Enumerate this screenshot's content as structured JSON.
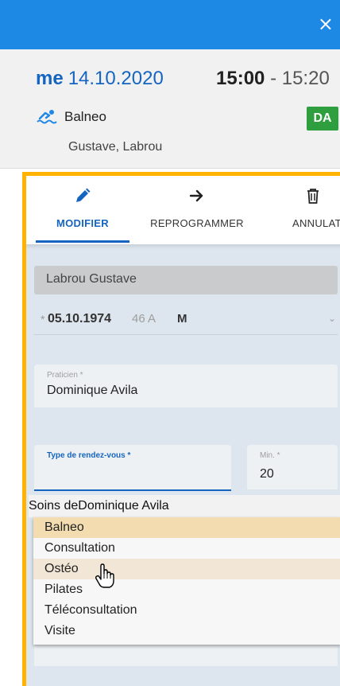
{
  "topbar": {
    "close_glyph": "×",
    "accent": "#1e88e5"
  },
  "appointment": {
    "day": "me",
    "date": "14.10.2020",
    "start": "15:00",
    "separator": "-",
    "end": "15:20",
    "activity": "Balneo",
    "activity_icon": "swimmer-icon",
    "badge": "DA",
    "badge_color": "#2e9e3e",
    "names": "Gustave, Labrou"
  },
  "tabs": [
    {
      "label": "MODIFIER",
      "icon": "pencil-icon",
      "active": true
    },
    {
      "label": "REPROGRAMMER",
      "icon": "arrow-right-icon",
      "active": false
    },
    {
      "label": "ANNULAT",
      "icon": "trash-icon",
      "active": false
    }
  ],
  "patient": {
    "name": "Labrou Gustave",
    "dob_marker": "*",
    "dob": "05.10.1974",
    "age": "46 A",
    "sex": "M"
  },
  "form": {
    "praticien_label": "Praticien *",
    "praticien_value": "Dominique Avila",
    "type_label": "Type de rendez-vous *",
    "type_value": "",
    "min_label": "Min. *",
    "min_value": "20"
  },
  "dropdown": {
    "group_label": "Soins deDominique Avila",
    "options": [
      "Balneo",
      "Consultation",
      "Ostéo",
      "Pilates",
      "Téléconsultation",
      "Visite"
    ],
    "selected": "Balneo",
    "hovered": "Ostéo"
  },
  "colors": {
    "frame": "#ffb300",
    "primary": "#1565c0"
  }
}
